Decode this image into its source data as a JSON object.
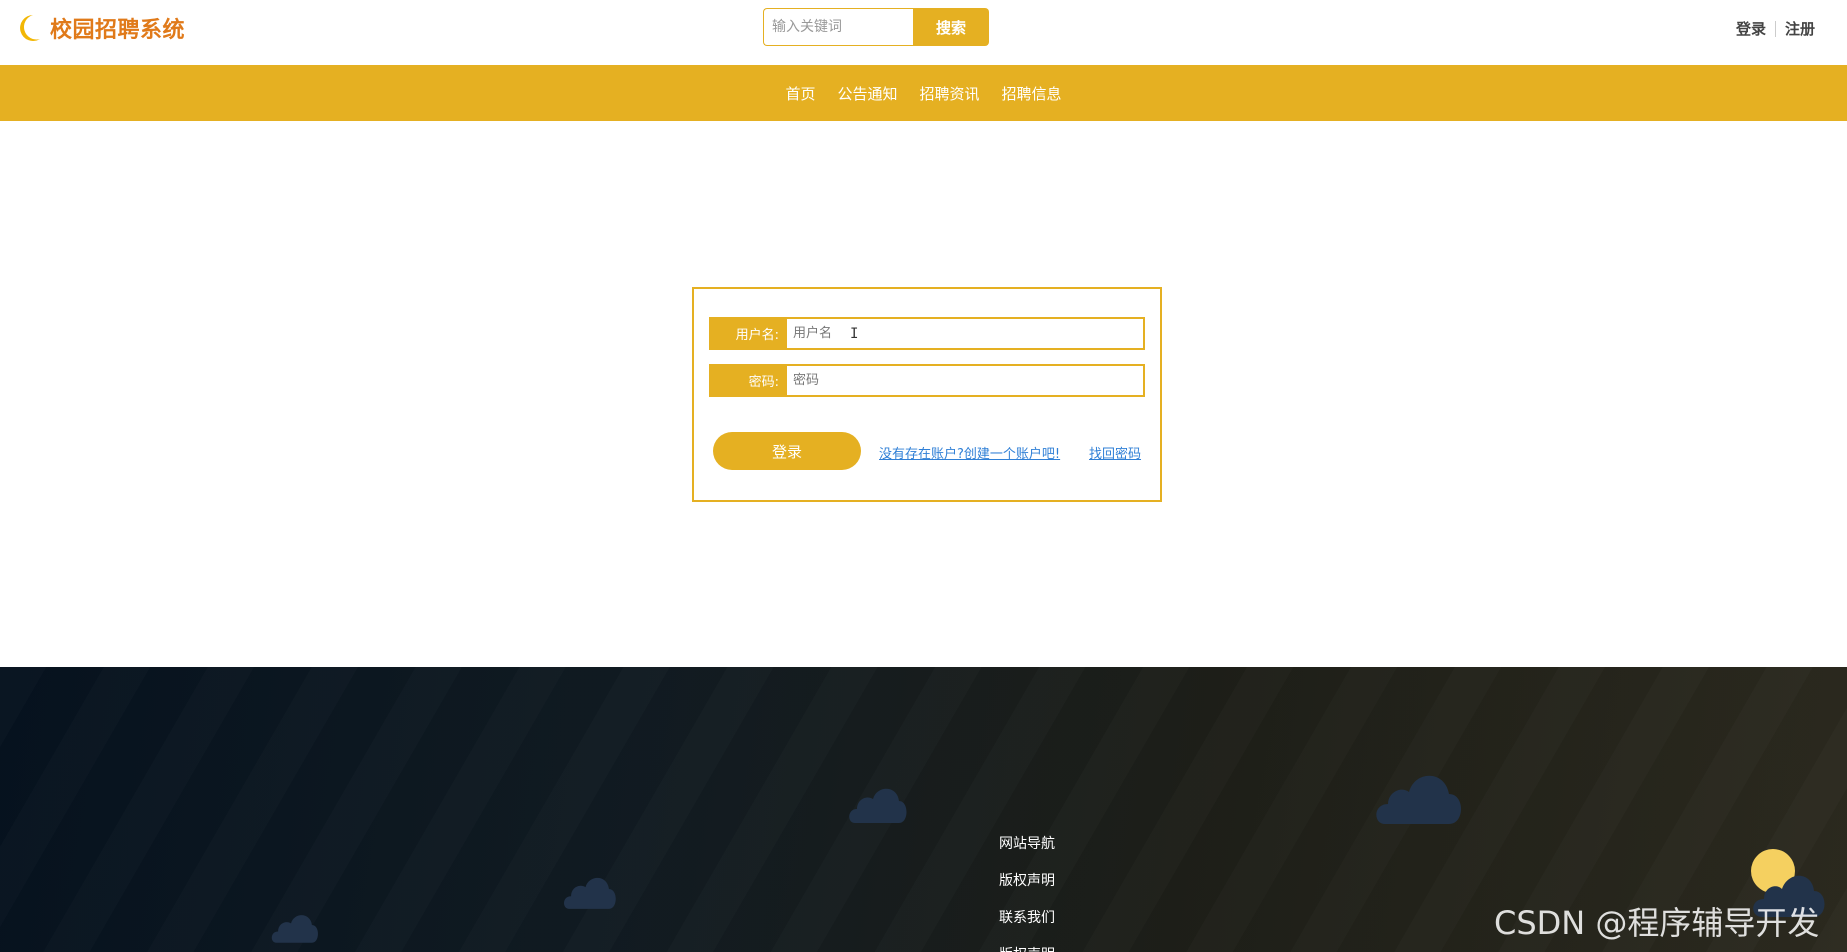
{
  "header": {
    "logo_text": "校园招聘系统",
    "search_placeholder": "输入关键词",
    "search_button": "搜索",
    "login_link": "登录",
    "register_link": "注册"
  },
  "nav": {
    "items": [
      "首页",
      "公告通知",
      "招聘资讯",
      "招聘信息"
    ]
  },
  "login_form": {
    "username_label": "用户名:",
    "username_placeholder": "用户名",
    "password_label": "密码:",
    "password_placeholder": "密码",
    "login_button": "登录",
    "register_link": "没有存在账户?创建一个账户吧!",
    "forgot_link": "找回密码"
  },
  "footer": {
    "links": [
      "网站导航",
      "版权声明",
      "联系我们",
      "版权声明"
    ]
  },
  "watermark": "CSDN @程序辅导开发",
  "colors": {
    "accent": "#e5b022",
    "logo": "#e07a1a",
    "link": "#2f7fd6",
    "footer_dark": "#06121f",
    "cloud": "#22334a",
    "sun": "#f5d060"
  }
}
